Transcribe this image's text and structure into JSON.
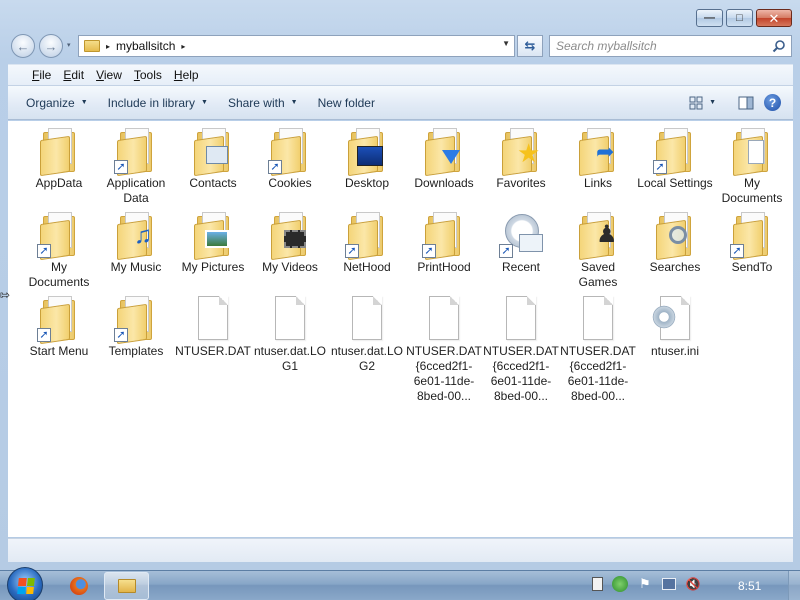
{
  "window": {
    "caption_buttons": {
      "minimize": "—",
      "maximize": "□",
      "close": "✕"
    }
  },
  "navbar": {
    "back_glyph": "←",
    "forward_glyph": "→",
    "history_glyph": "▾",
    "crumb_separator": "▸",
    "breadcrumb": [
      "myballsitch"
    ],
    "trailing_separator": "▸",
    "address_dropdown": "▼",
    "refresh_glyph": "⇆",
    "search_placeholder": "Search myballsitch"
  },
  "menubar": [
    {
      "key": "F",
      "rest": "ile"
    },
    {
      "key": "E",
      "rest": "dit"
    },
    {
      "key": "V",
      "rest": "iew"
    },
    {
      "key": "T",
      "rest": "ools"
    },
    {
      "key": "H",
      "rest": "elp"
    }
  ],
  "commandbar": {
    "organize": "Organize",
    "include_in_library": "Include in library",
    "share_with": "Share with",
    "new_folder": "New folder",
    "caret": "▼",
    "help": "?"
  },
  "items": [
    {
      "label": "AppData",
      "icon": "folder",
      "shortcut": false
    },
    {
      "label": "Application Data",
      "icon": "folder",
      "shortcut": true
    },
    {
      "label": "Contacts",
      "icon": "folder-contacts",
      "shortcut": false
    },
    {
      "label": "Cookies",
      "icon": "folder",
      "shortcut": true
    },
    {
      "label": "Desktop",
      "icon": "folder-desktop",
      "shortcut": false
    },
    {
      "label": "Downloads",
      "icon": "folder-downloads",
      "shortcut": false
    },
    {
      "label": "Favorites",
      "icon": "folder-favorites",
      "shortcut": false
    },
    {
      "label": "Links",
      "icon": "folder-links",
      "shortcut": false
    },
    {
      "label": "Local Settings",
      "icon": "folder",
      "shortcut": true
    },
    {
      "label": "My Documents",
      "icon": "folder-documents",
      "shortcut": false
    },
    {
      "label": "My Documents",
      "icon": "folder",
      "shortcut": true
    },
    {
      "label": "My Music",
      "icon": "folder-music",
      "shortcut": false
    },
    {
      "label": "My Pictures",
      "icon": "folder-pictures",
      "shortcut": false
    },
    {
      "label": "My Videos",
      "icon": "folder-videos",
      "shortcut": false
    },
    {
      "label": "NetHood",
      "icon": "folder",
      "shortcut": true
    },
    {
      "label": "PrintHood",
      "icon": "folder",
      "shortcut": true
    },
    {
      "label": "Recent",
      "icon": "recent",
      "shortcut": true
    },
    {
      "label": "Saved Games",
      "icon": "folder-games",
      "shortcut": false
    },
    {
      "label": "Searches",
      "icon": "folder-searches",
      "shortcut": false
    },
    {
      "label": "SendTo",
      "icon": "folder",
      "shortcut": true
    },
    {
      "label": "Start Menu",
      "icon": "folder",
      "shortcut": true
    },
    {
      "label": "Templates",
      "icon": "folder",
      "shortcut": true
    },
    {
      "label": "NTUSER.DAT",
      "icon": "file",
      "shortcut": false
    },
    {
      "label": "ntuser.dat.LOG1",
      "icon": "file",
      "shortcut": false
    },
    {
      "label": "ntuser.dat.LOG2",
      "icon": "file",
      "shortcut": false
    },
    {
      "label": "NTUSER.DAT{6cced2f1-6e01-11de-8bed-00...",
      "icon": "file",
      "shortcut": false
    },
    {
      "label": "NTUSER.DAT{6cced2f1-6e01-11de-8bed-00...",
      "icon": "file",
      "shortcut": false
    },
    {
      "label": "NTUSER.DAT{6cced2f1-6e01-11de-8bed-00...",
      "icon": "file",
      "shortcut": false
    },
    {
      "label": "ntuser.ini",
      "icon": "file-settings",
      "shortcut": false
    }
  ],
  "side_cursor": "⇰",
  "taskbar": {
    "clock": "8:51"
  }
}
